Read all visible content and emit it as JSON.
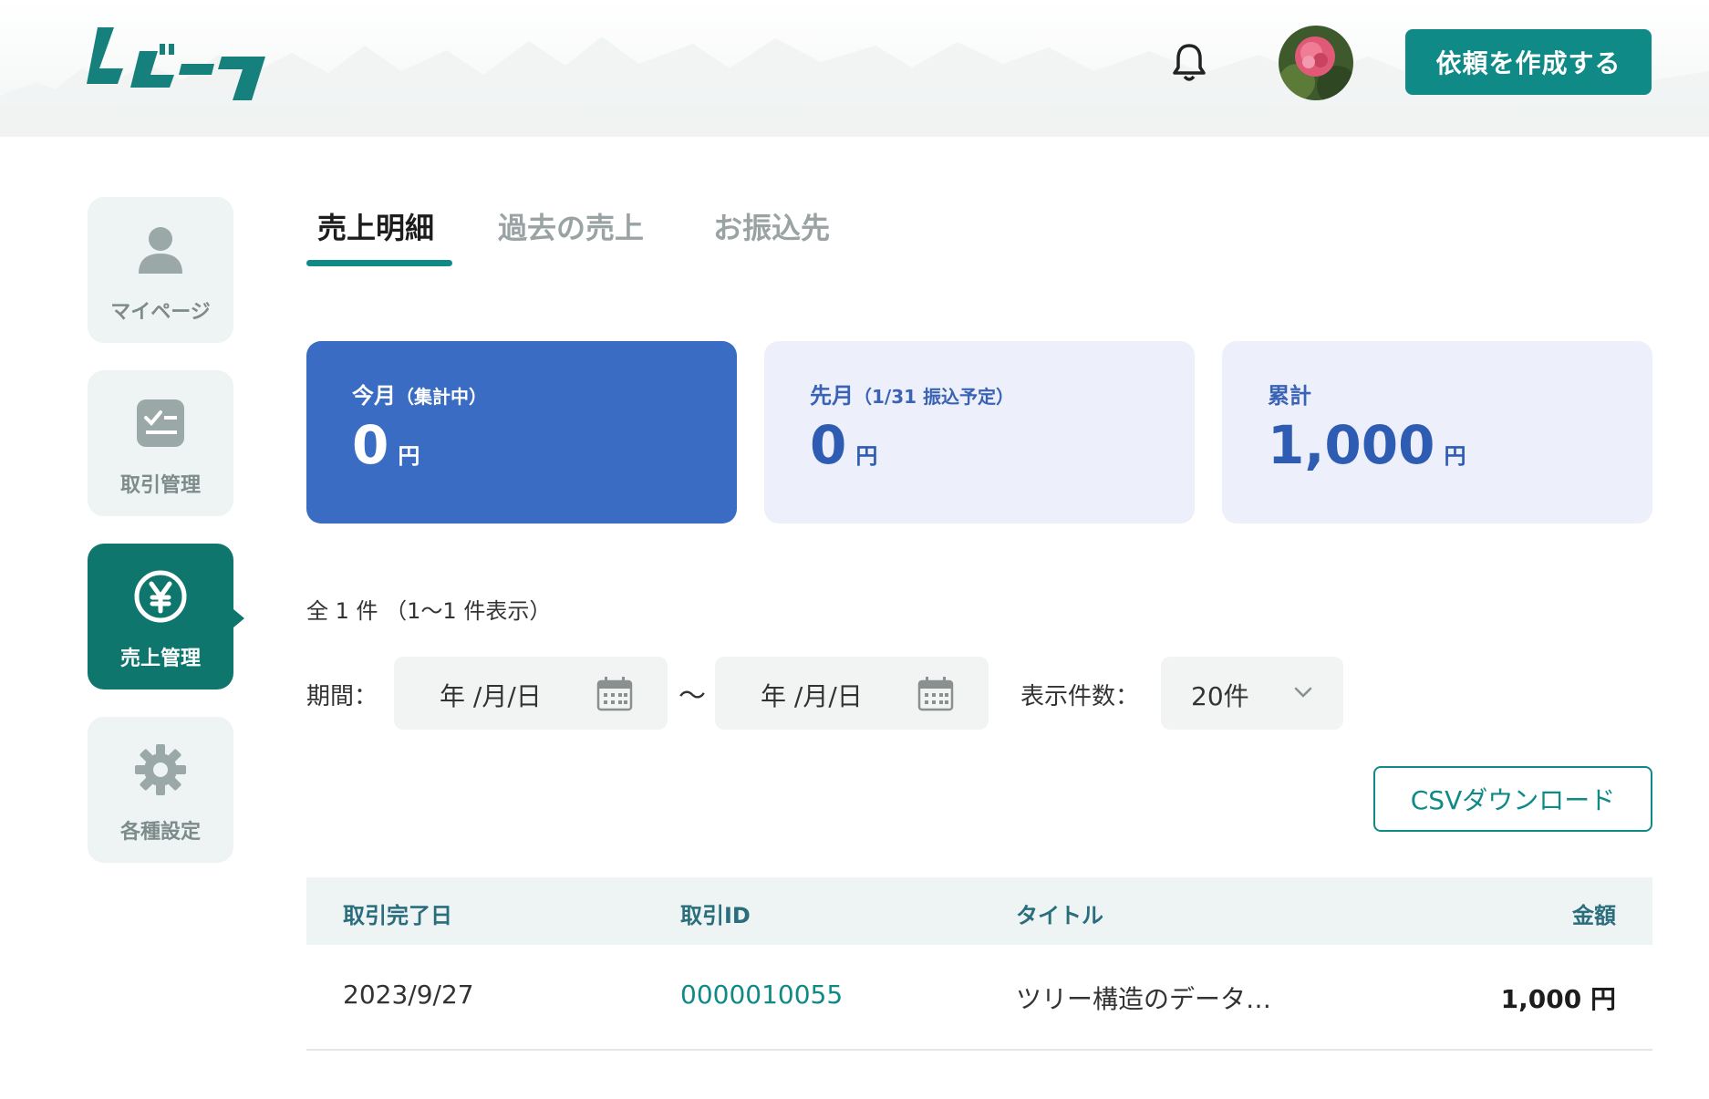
{
  "header": {
    "logo_text": "ムビース",
    "create_button": "依頼を作成する"
  },
  "sidebar": {
    "items": [
      {
        "label": "マイページ",
        "icon": "user-icon"
      },
      {
        "label": "取引管理",
        "icon": "checklist-icon"
      },
      {
        "label": "売上管理",
        "icon": "yen-icon",
        "active": true
      },
      {
        "label": "各種設定",
        "icon": "gear-icon"
      }
    ]
  },
  "tabs": [
    {
      "label": "売上明細",
      "active": true
    },
    {
      "label": "過去の売上"
    },
    {
      "label": "お振込先"
    }
  ],
  "cards": [
    {
      "label": "今月",
      "sub": "（集計中）",
      "value": "0",
      "unit": "円"
    },
    {
      "label": "先月",
      "sub": "（1/31 振込予定）",
      "value": "0",
      "unit": "円"
    },
    {
      "label": "累計",
      "sub": "",
      "value": "1,000",
      "unit": "円"
    }
  ],
  "filters": {
    "count_text": "全 1 件 （1〜1 件表示）",
    "period_label": "期間：",
    "date_placeholder": "年 /月/日",
    "tilde": "〜",
    "per_page_label": "表示件数：",
    "per_page_value": "20件"
  },
  "csv_button": "CSVダウンロード",
  "table": {
    "columns": [
      "取引完了日",
      "取引ID",
      "タイトル",
      "金額"
    ],
    "rows": [
      {
        "date": "2023/9/27",
        "id": "0000010055",
        "title": "ツリー構造のデータ…",
        "amount": "1,000 円"
      }
    ]
  },
  "colors": {
    "brand": "#0f8a86",
    "card_blue": "#3a6cc4",
    "card_light": "#edf0fa"
  }
}
